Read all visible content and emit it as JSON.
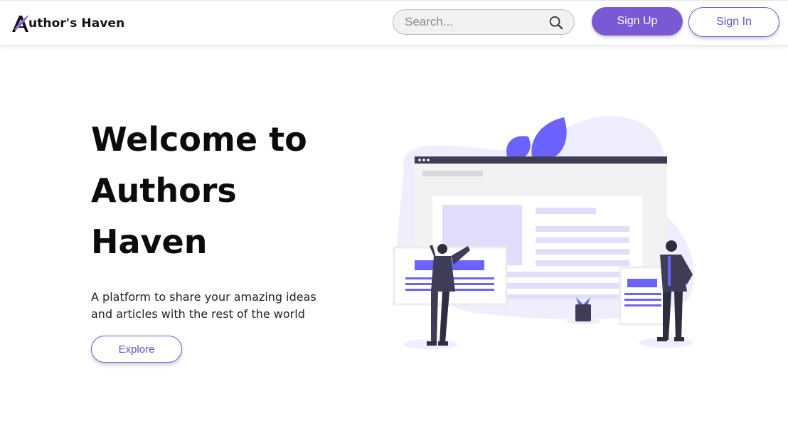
{
  "brand": {
    "name": "uthor's Haven",
    "logo_icon": "quill-a-logo",
    "accent": "#7b59d4"
  },
  "search": {
    "placeholder": "Search...",
    "icon": "search-icon"
  },
  "nav": {
    "signup_label": "Sign Up",
    "signin_label": "Sign In"
  },
  "hero": {
    "title": "Welcome to Authors Haven",
    "subtitle": "A platform to share your amazing ideas and articles with the rest of the world",
    "explore_label": "Explore",
    "illustration": "people-building-website-illustration"
  }
}
